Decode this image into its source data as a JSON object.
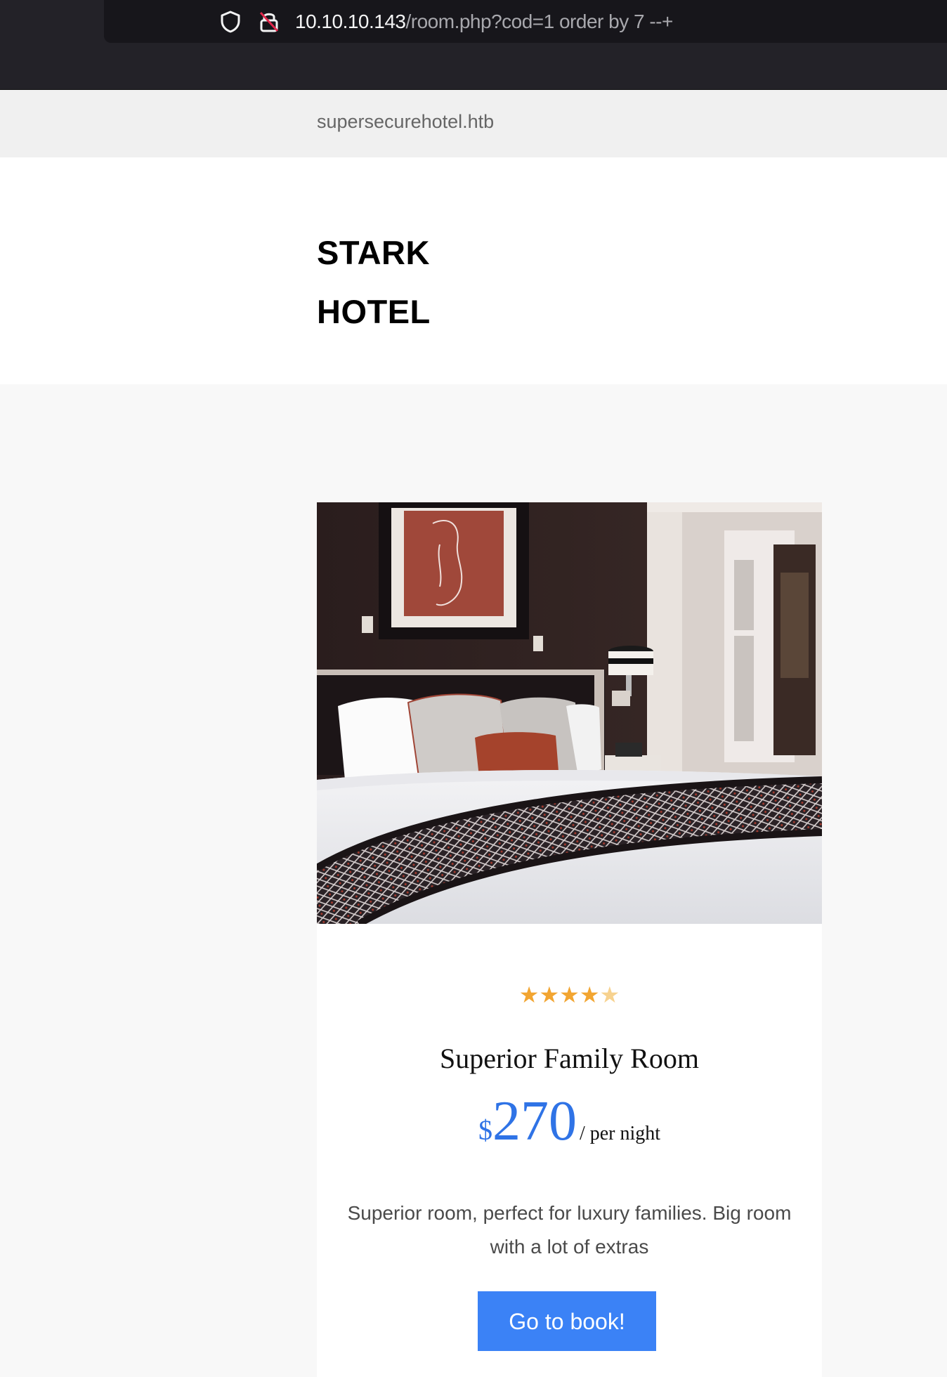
{
  "browser": {
    "url_host": "10.10.10.143",
    "url_path": "/room.php?cod=1 order by 7 --+"
  },
  "site": {
    "domain": "supersecurehotel.htb"
  },
  "header": {
    "brand_line1": "STARK",
    "brand_line2": "HOTEL"
  },
  "room": {
    "rating": 4,
    "rating_max": 5,
    "title": "Superior Family Room",
    "currency": "$",
    "price": "270",
    "price_unit": "/ per night",
    "description": "Superior room, perfect for luxury families. Big room with a lot of extras",
    "book_label": "Go to book!"
  },
  "colors": {
    "accent": "#3b82f6",
    "price": "#2f73e6",
    "star": "#f2a531"
  }
}
